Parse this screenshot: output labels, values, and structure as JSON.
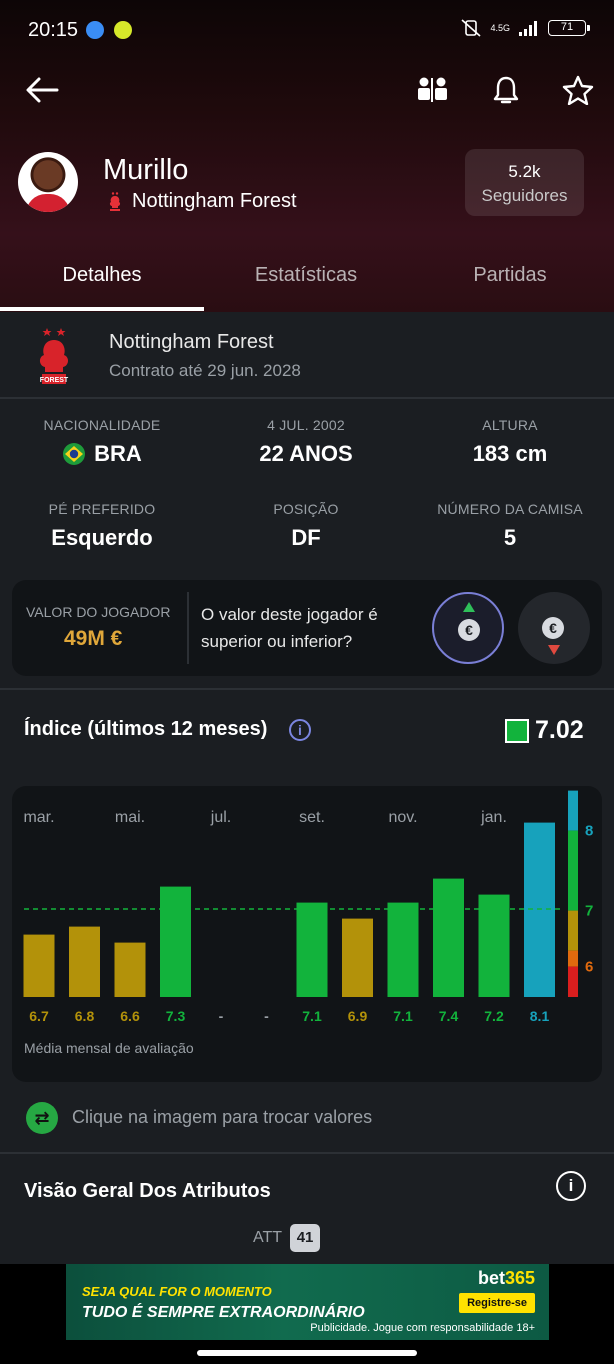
{
  "status": {
    "time": "20:15",
    "network": "4.5G",
    "battery": "71"
  },
  "player": {
    "name": "Murillo",
    "club": "Nottingham Forest",
    "followers_count": "5.2k",
    "followers_label": "Seguidores"
  },
  "tabs": [
    {
      "label": "Detalhes",
      "active": true
    },
    {
      "label": "Estatísticas",
      "active": false
    },
    {
      "label": "Partidas",
      "active": false
    }
  ],
  "contract": {
    "team": "Nottingham Forest",
    "until": "Contrato até 29 jun. 2028"
  },
  "details": {
    "nationality_label": "NACIONALIDADE",
    "nationality_value": "BRA",
    "birth_label": "4 JUL. 2002",
    "age_value": "22 ANOS",
    "height_label": "ALTURA",
    "height_value": "183 cm",
    "foot_label": "PÉ PREFERIDO",
    "foot_value": "Esquerdo",
    "position_label": "POSIÇÃO",
    "position_value": "DF",
    "shirt_label": "NÚMERO DA CAMISA",
    "shirt_value": "5"
  },
  "market_value": {
    "label": "VALOR DO JOGADOR",
    "amount": "49M €",
    "question": "O valor deste jogador é superior ou inferior?",
    "euro_symbol": "€"
  },
  "index": {
    "title": "Índice (últimos 12 meses)",
    "value": "7.02",
    "info_symbol": "i"
  },
  "chart_data": {
    "type": "bar",
    "caption": "Média mensal de avaliação",
    "month_labels": [
      "mar.",
      "mai.",
      "jul.",
      "set.",
      "nov.",
      "jan."
    ],
    "values": [
      6.7,
      6.8,
      6.6,
      7.3,
      null,
      null,
      7.1,
      6.9,
      7.1,
      7.4,
      7.2,
      8.1
    ],
    "value_labels": [
      "6.7",
      "6.8",
      "6.6",
      "7.3",
      "-",
      "-",
      "7.1",
      "6.9",
      "7.1",
      "7.4",
      "7.2",
      "8.1"
    ],
    "average": 7.02,
    "ylim": [
      6.0,
      8.5
    ],
    "scale_ticks": [
      "8",
      "7",
      "6"
    ],
    "colors": {
      "below_7": "#b3920a",
      "range_7_8": "#12b33c",
      "above_8": "#17a2bc",
      "average_line": "#12b33c",
      "low": "#d91e1e",
      "mid_low": "#e06a0e"
    }
  },
  "toggle": {
    "text": "Clique na imagem para trocar valores"
  },
  "attributes": {
    "title": "Visão Geral Dos Atributos",
    "info_symbol": "i",
    "att_label": "ATT",
    "att_value": "41"
  },
  "ad": {
    "line1": "SEJA QUAL FOR O MOMENTO",
    "line2": "TUDO É SEMPRE EXTRAORDINÁRIO",
    "brand_a": "bet",
    "brand_b": "365",
    "register": "Registre-se",
    "disclaimer": "Publicidade. Jogue com responsabilidade 18+"
  }
}
